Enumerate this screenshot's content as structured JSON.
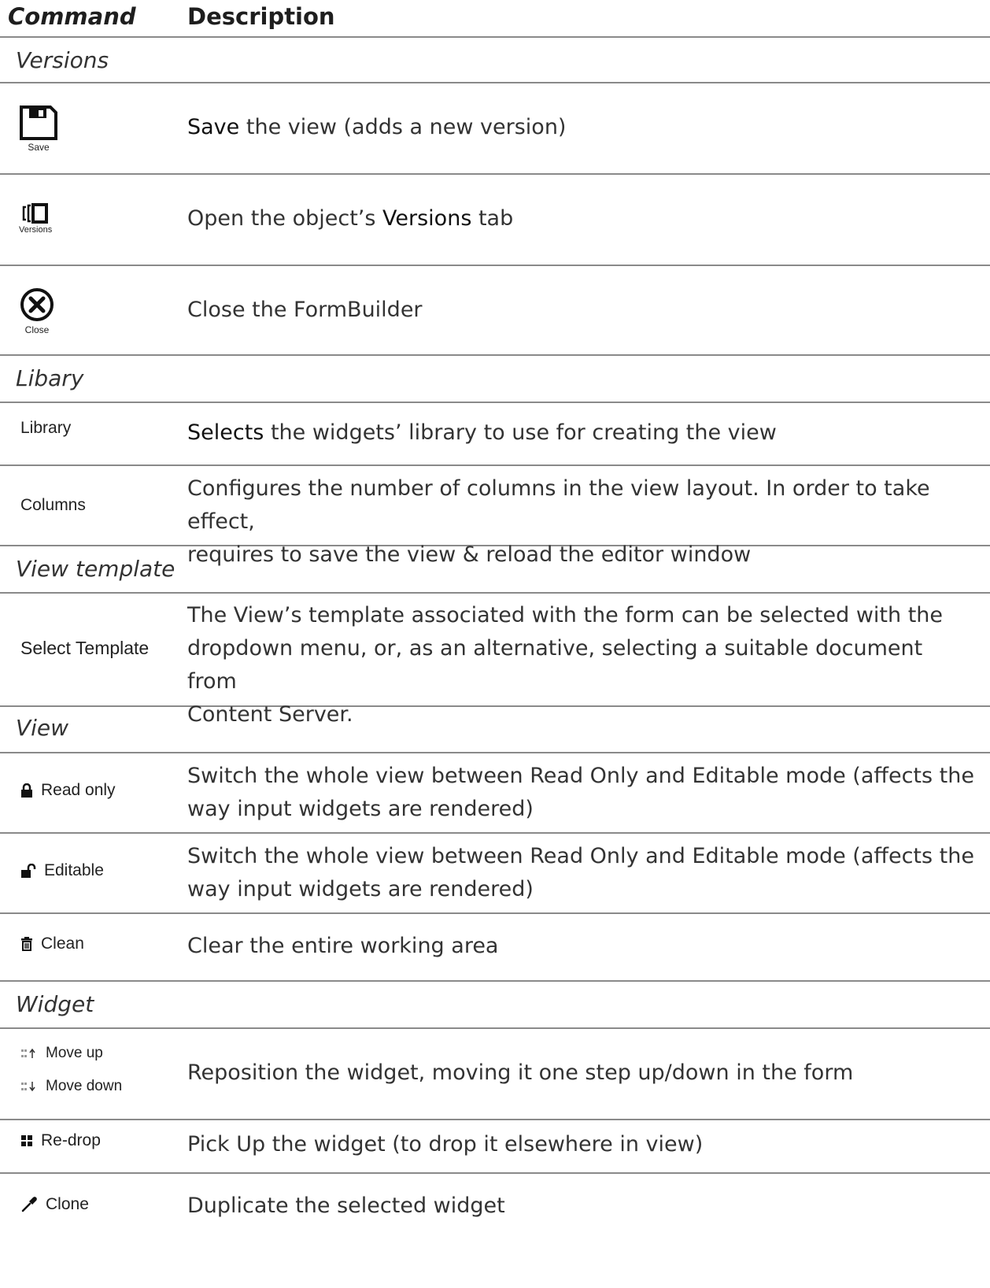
{
  "header": {
    "command": "Command",
    "description": "Description"
  },
  "sections": {
    "versions": "Versions",
    "library": "Libary",
    "view_template": "View template",
    "view": "View",
    "widget": "Widget"
  },
  "rows": {
    "save": {
      "caption": "Save",
      "bold": "Save",
      "rest": " the view (adds a new version)",
      "icon": "save-icon"
    },
    "versions": {
      "caption": "Versions",
      "pre": "Open the object’s ",
      "bold": "Versions",
      "post": " tab",
      "icon": "versions-icon"
    },
    "close": {
      "caption": "Close",
      "desc": "Close the FormBuilder",
      "icon": "close-circle-icon"
    },
    "library": {
      "label": "Library",
      "bold": "Selects",
      "rest": " the widgets’ library to use for creating the view"
    },
    "columns": {
      "label": "Columns",
      "line1": "Configures the number of columns in the view layout. In order to take effect,",
      "line2": "requires to save the view & reload the editor window"
    },
    "select_template": {
      "label": "Select Template",
      "line1": "The View’s template associated with the form can be selected with the",
      "line2": "dropdown menu, or, as an alternative, selecting a suitable document from",
      "line3": "Content Server."
    },
    "read_only": {
      "label": "Read only",
      "icon": "lock-icon",
      "line1": "Switch the whole view between Read Only and Editable mode (affects the",
      "line2": "way input widgets are rendered)"
    },
    "editable": {
      "label": "Editable",
      "icon": "unlock-icon",
      "line1": "Switch the whole view between Read Only and Editable mode (affects the",
      "line2": "way input widgets are rendered)"
    },
    "clean": {
      "label": "Clean",
      "icon": "trash-icon",
      "desc": "Clear the entire working area"
    },
    "move": {
      "label_up": "Move up",
      "label_down": "Move down",
      "icon_up": "move-up-icon",
      "icon_down": "move-down-icon",
      "desc": "Reposition the widget, moving it one step up/down in the form"
    },
    "redrop": {
      "label": "Re-drop",
      "icon": "grid-icon",
      "desc": "Pick Up the widget (to drop it elsewhere in view)"
    },
    "clone": {
      "label": "Clone",
      "icon": "dropper-icon",
      "desc": "Duplicate the selected widget"
    }
  }
}
